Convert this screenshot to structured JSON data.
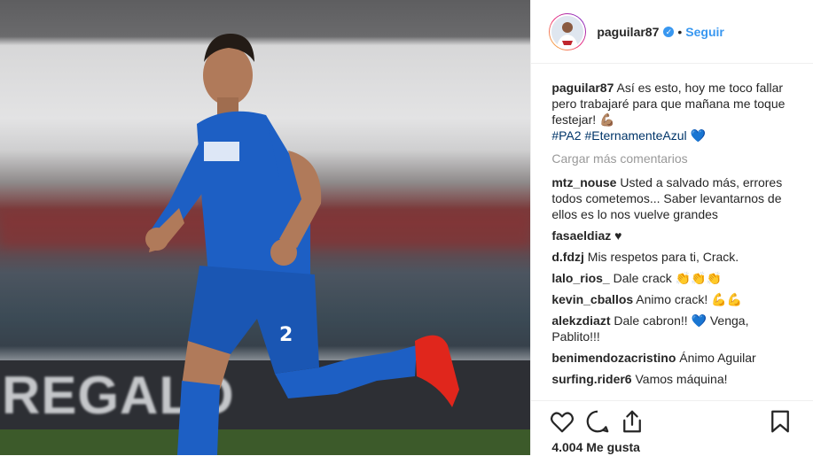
{
  "post": {
    "username": "paguilar87",
    "verified_label": "✓",
    "dot": "•",
    "follow_label": "Seguir",
    "caption_user": "paguilar87",
    "caption_text": "Así es esto, hoy me toco fallar pero trabajaré para que mañana me toque festejar! 💪🏽",
    "caption_tags": "#PA2 #EternamenteAzul 💙",
    "load_more": "Cargar más comentarios",
    "likes": "4.004 Me gusta"
  },
  "photo": {
    "board_text": "REGALO"
  },
  "comments": [
    {
      "user": "mtz_nouse",
      "text": "Usted a salvado más, errores todos cometemos... Saber levantarnos de ellos es lo nos vuelve grandes"
    },
    {
      "user": "fasaeldiaz",
      "text": "♥"
    },
    {
      "user": "d.fdzj",
      "text": "Mis respetos para ti, Crack."
    },
    {
      "user": "lalo_rios_",
      "text": "Dale crack 👏👏👏"
    },
    {
      "user": "kevin_cballos",
      "text": "Animo crack! 💪💪"
    },
    {
      "user": "alekzdiazt",
      "text": "Dale cabron!! 💙 Venga, Pablito!!!"
    },
    {
      "user": "benimendozacristino",
      "text": "Ánimo Aguilar"
    },
    {
      "user": "surfing.rider6",
      "text": "Vamos máquina!"
    }
  ],
  "icons": {
    "like": "heart-icon",
    "comment": "comment-icon",
    "share": "share-icon",
    "save": "bookmark-icon"
  }
}
